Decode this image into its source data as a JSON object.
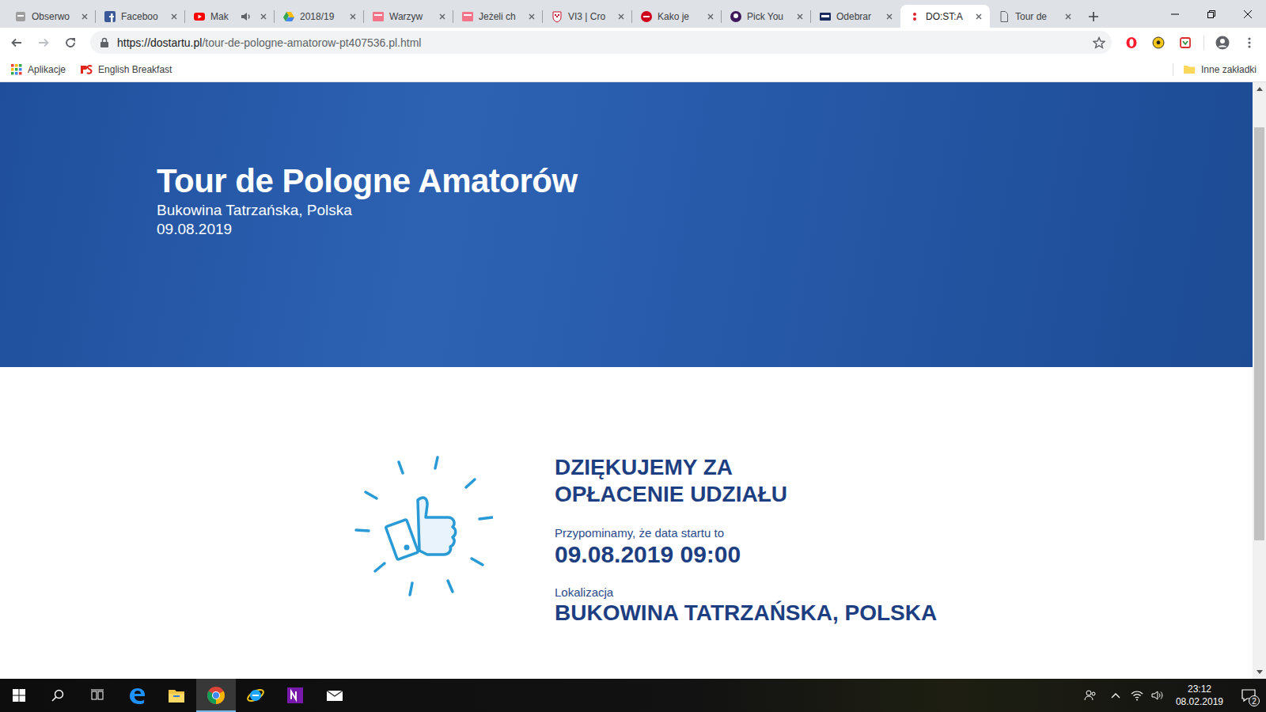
{
  "tabs": [
    {
      "label": "Obserwo",
      "selected": false,
      "audio": false
    },
    {
      "label": "Faceboo",
      "selected": false,
      "audio": false
    },
    {
      "label": "Mak",
      "selected": false,
      "audio": true
    },
    {
      "label": "2018/19",
      "selected": false,
      "audio": false
    },
    {
      "label": "Warzyw",
      "selected": false,
      "audio": false
    },
    {
      "label": "Jeżeli ch",
      "selected": false,
      "audio": false
    },
    {
      "label": "VI3 | Cro",
      "selected": false,
      "audio": false
    },
    {
      "label": "Kako je",
      "selected": false,
      "audio": false
    },
    {
      "label": "Pick You",
      "selected": false,
      "audio": false
    },
    {
      "label": "Odebrar",
      "selected": false,
      "audio": false
    },
    {
      "label": "DO:ST:A",
      "selected": true,
      "audio": false
    },
    {
      "label": "Tour de",
      "selected": false,
      "audio": false
    }
  ],
  "address_bar": {
    "url_host": "https://dostartu.pl",
    "url_path": "/tour-de-pologne-amatorow-pt407536.pl.html"
  },
  "bookmarks": {
    "items": [
      "Aplikacje",
      "English Breakfast"
    ],
    "other": "Inne zakładki"
  },
  "hero": {
    "title": "Tour de Pologne Amatorów",
    "place": "Bukowina Tatrzańska, Polska",
    "date": "09.08.2019"
  },
  "confirmation": {
    "heading": [
      "DZIĘKUJEMY ZA",
      "OPŁACENIE UDZIAŁU"
    ],
    "reminder": "Przypominamy, że data startu to",
    "start": "09.08.2019 09:00",
    "location_label": "Lokalizacja",
    "location": "BUKOWINA TATRZAŃSKA, POLSKA"
  },
  "taskbar": {
    "time": "23:12",
    "date": "08.02.2019",
    "notifications": "2"
  }
}
